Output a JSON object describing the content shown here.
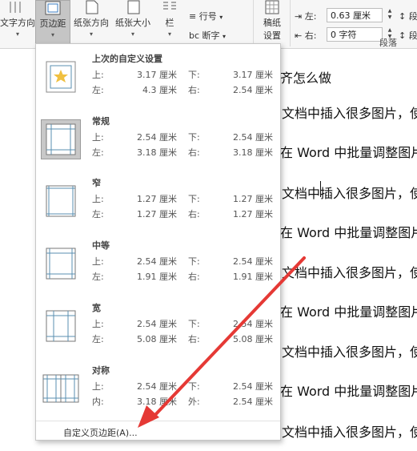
{
  "ribbon": {
    "text_direction": "文字方向",
    "margins": "页边距",
    "orientation": "纸张方向",
    "size": "纸张大小",
    "columns": "栏",
    "line_numbers": "行号",
    "hyphenation": "断字",
    "draft_settings_line1": "稿纸",
    "draft_settings_line2": "设置",
    "indent_left_label": "左:",
    "indent_left_value": "0.63 厘米",
    "indent_right_label": "右:",
    "indent_right_value": "0 字符",
    "spacing_left_label": "段",
    "spacing_right_label": "段",
    "paragraph_group": "段落"
  },
  "document": {
    "lines": [
      "齐怎么做",
      "文档中插入很多图片，使",
      "在 Word 中批量调整图片",
      "文档中插入很多图片，使",
      "在 Word 中批量调整图片",
      "文档中插入很多图片，使",
      "在 Word 中批量调整图片",
      "文档中插入很多图片，使",
      "在 Word 中批量调整图片",
      "文档中插入很多图片，使"
    ]
  },
  "menu": {
    "items": [
      {
        "name": "上次的自定义设置",
        "l1": "上:",
        "v1": "3.17 厘米",
        "l2": "下:",
        "v2": "3.17 厘米",
        "l3": "左:",
        "v3": "4.3 厘米",
        "l4": "右:",
        "v4": "2.54 厘米"
      },
      {
        "name": "常规",
        "l1": "上:",
        "v1": "2.54 厘米",
        "l2": "下:",
        "v2": "2.54 厘米",
        "l3": "左:",
        "v3": "3.18 厘米",
        "l4": "右:",
        "v4": "3.18 厘米"
      },
      {
        "name": "窄",
        "l1": "上:",
        "v1": "1.27 厘米",
        "l2": "下:",
        "v2": "1.27 厘米",
        "l3": "左:",
        "v3": "1.27 厘米",
        "l4": "右:",
        "v4": "1.27 厘米"
      },
      {
        "name": "中等",
        "l1": "上:",
        "v1": "2.54 厘米",
        "l2": "下:",
        "v2": "2.54 厘米",
        "l3": "左:",
        "v3": "1.91 厘米",
        "l4": "右:",
        "v4": "1.91 厘米"
      },
      {
        "name": "宽",
        "l1": "上:",
        "v1": "2.54 厘米",
        "l2": "下:",
        "v2": "2.54 厘米",
        "l3": "左:",
        "v3": "5.08 厘米",
        "l4": "右:",
        "v4": "5.08 厘米"
      },
      {
        "name": "对称",
        "l1": "上:",
        "v1": "2.54 厘米",
        "l2": "下:",
        "v2": "2.54 厘米",
        "l3": "内:",
        "v3": "3.18 厘米",
        "l4": "外:",
        "v4": "2.54 厘米"
      }
    ],
    "custom": "自定义页边距(A)..."
  },
  "colors": {
    "annotation_arrow": "#e53935",
    "thumb_line": "#5a8fb0",
    "star": "#f0c040"
  }
}
